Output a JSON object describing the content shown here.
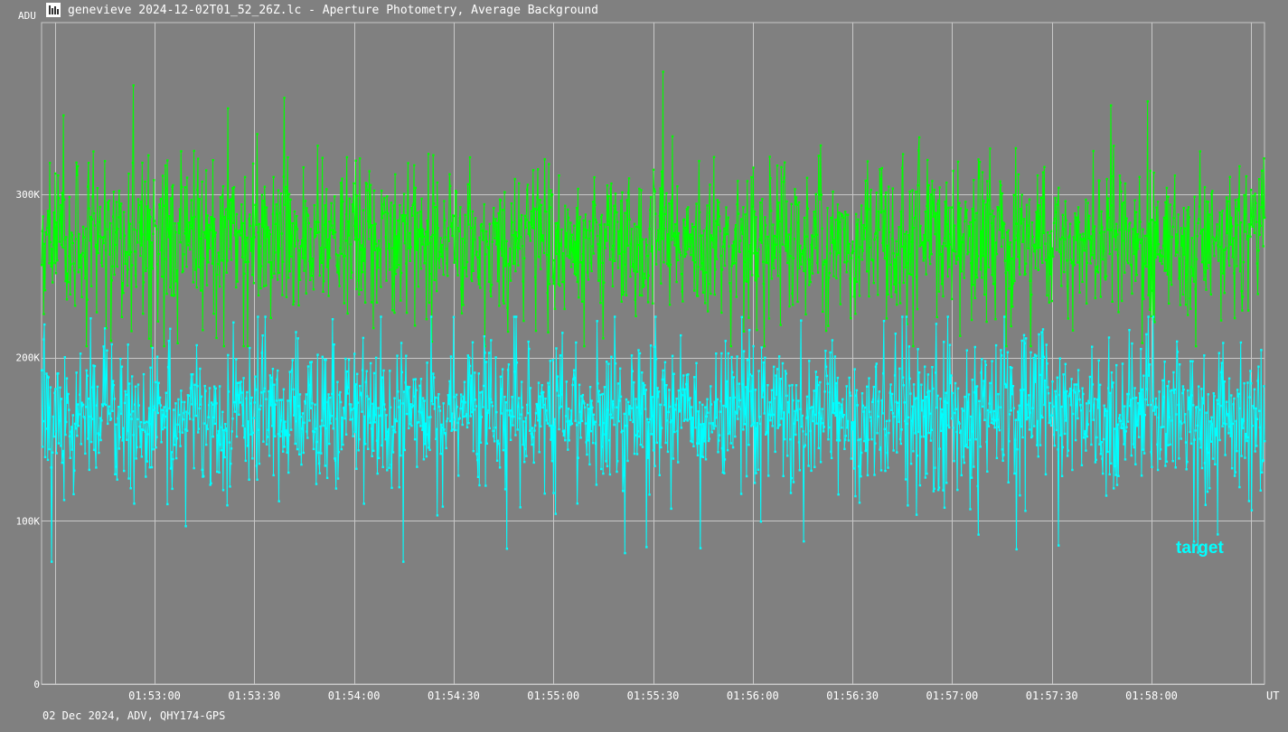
{
  "window": {
    "title": "genevieve 2024-12-02T01_52_26Z.lc - Aperture Photometry, Average Background",
    "icon": "tangra-app-icon"
  },
  "footer": {
    "text": "02 Dec 2024, ADV, QHY174-GPS"
  },
  "colors": {
    "background": "#808080",
    "grid": "#c8c8c8",
    "axis_text": "#ffffff",
    "background_series": "#00ff00",
    "target_series": "#00ffff"
  },
  "chart_data": {
    "type": "line",
    "title": "",
    "xlabel": "UT",
    "ylabel": "ADU",
    "grid": true,
    "x_ticks": [
      "01:53:00",
      "01:53:30",
      "01:54:00",
      "01:54:30",
      "01:55:00",
      "01:55:30",
      "01:56:00",
      "01:56:30",
      "01:57:00",
      "01:57:30",
      "01:58:00"
    ],
    "y_ticks": [
      "0",
      "100K",
      "200K",
      "300K"
    ],
    "y_tick_values": [
      0,
      100000,
      200000,
      300000
    ],
    "ylim": [
      0,
      405000
    ],
    "xlim": [
      "01:52:26",
      "01:58:34"
    ],
    "markers": true,
    "series": [
      {
        "name": "",
        "color": "#00ff00",
        "mean": 272000,
        "typical_range": [
          240000,
          305000
        ],
        "min": 207000,
        "max": 375000,
        "note_points": [
          {
            "x": "01:55:33",
            "y": 375000
          },
          {
            "x": "01:53:39",
            "y": 359000
          }
        ]
      },
      {
        "name": "target",
        "color": "#00ffff",
        "mean": 165000,
        "typical_range": [
          135000,
          195000
        ],
        "min": 75000,
        "max": 225000,
        "note_points": [
          {
            "x": "01:52:29",
            "y": 75000
          },
          {
            "x": "01:54:46",
            "y": 83000
          },
          {
            "x": "01:55:28",
            "y": 84000
          },
          {
            "x": "01:57:32",
            "y": 85000
          }
        ]
      }
    ],
    "annotations": [
      {
        "text": "target",
        "color": "#00ffff",
        "placement": "lower-right"
      }
    ]
  }
}
